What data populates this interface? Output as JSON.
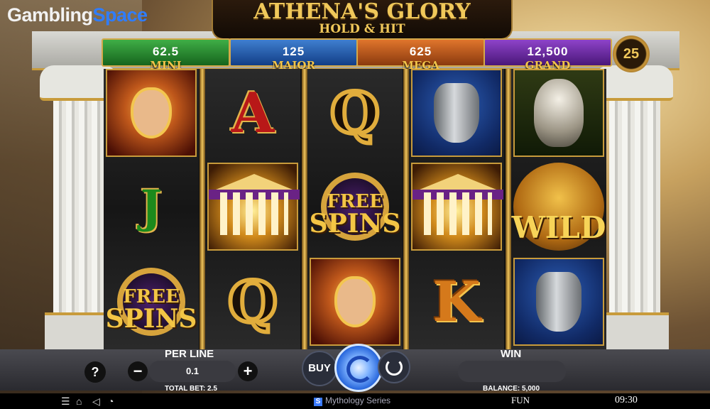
{
  "watermark": {
    "part1": "Gambling",
    "part2": "Space"
  },
  "logo": {
    "line1": "ATHENA'S GLORY",
    "line2": "HOLD & HIT"
  },
  "jackpots": [
    {
      "label": "MINI",
      "value": "62.5"
    },
    {
      "label": "MAJOR",
      "value": "125"
    },
    {
      "label": "MEGA",
      "value": "625"
    },
    {
      "label": "GRAND",
      "value": "12,500"
    }
  ],
  "lines_count": "25",
  "reels": [
    [
      "athena",
      "J",
      "free-spins"
    ],
    [
      "A",
      "temple",
      "Q"
    ],
    [
      "Q",
      "free-spins",
      "athena"
    ],
    [
      "vase",
      "temple",
      "K"
    ],
    [
      "owl",
      "wild",
      "vase"
    ]
  ],
  "symbols": {
    "A": "A",
    "J": "J",
    "Q": "Q",
    "K": "K",
    "free1": "FREE",
    "free2": "SPINS",
    "wild": "WILD"
  },
  "controls": {
    "help": "?",
    "per_line_label": "PER LINE",
    "per_line_value": "0.1",
    "minus": "−",
    "plus": "+",
    "buy": "BUY",
    "win_label": "WIN",
    "total_bet": "TOTAL BET: 2.5",
    "balance": "BALANCE: 5,000"
  },
  "statusbar": {
    "series": "Mythology Series",
    "series_logo": "S",
    "mode": "FUN",
    "clock": "09:30",
    "icons": [
      "menu-icon",
      "home-icon",
      "sound-off-icon",
      "speed-icon"
    ]
  },
  "colors": {
    "mini": "#16641d",
    "major": "#123e86",
    "mega": "#8a3a0e",
    "grand": "#4a1779",
    "spin": "#1b5bd6"
  }
}
